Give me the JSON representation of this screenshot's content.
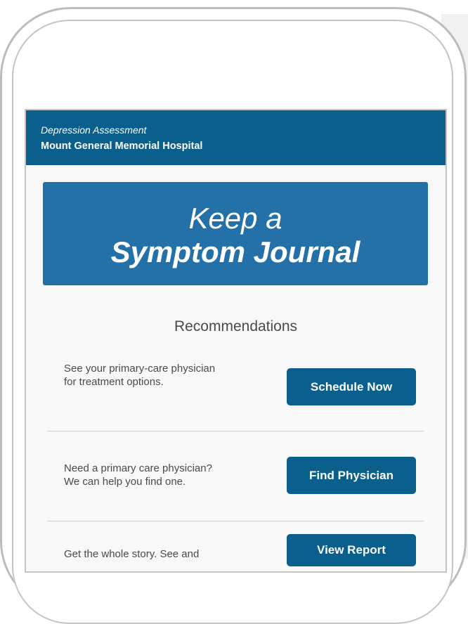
{
  "header": {
    "subtitle": "Depression Assessment",
    "title": "Mount General Memorial Hospital"
  },
  "banner": {
    "line1": "Keep a",
    "line2": "Symptom Journal"
  },
  "recommendations": {
    "heading": "Recommendations",
    "items": [
      {
        "text": "See your primary-care physician for treatment options.",
        "button": "Schedule Now"
      },
      {
        "text": "Need a primary care physician? We can help you find one.",
        "button": "Find Physician"
      },
      {
        "text": "Get the whole story. See and",
        "button": "View Report"
      }
    ]
  },
  "colors": {
    "header_bg": "#0b5f8d",
    "banner_bg": "#2371a8",
    "button_bg": "#0b5f8d",
    "text": "#4a4a4a"
  }
}
